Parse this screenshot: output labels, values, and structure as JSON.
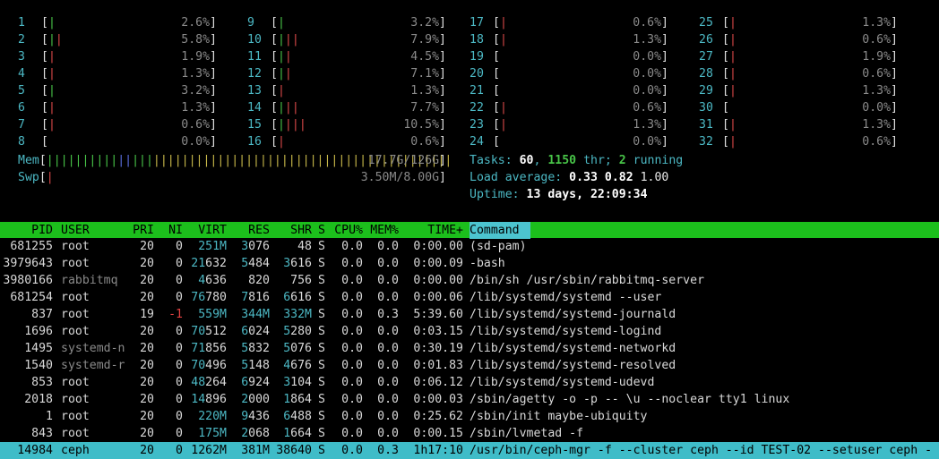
{
  "cpus": [
    {
      "n": "1",
      "pct": "2.6%"
    },
    {
      "n": "2",
      "pct": "5.8%"
    },
    {
      "n": "3",
      "pct": "1.9%"
    },
    {
      "n": "4",
      "pct": "1.3%"
    },
    {
      "n": "5",
      "pct": "3.2%"
    },
    {
      "n": "6",
      "pct": "1.3%"
    },
    {
      "n": "7",
      "pct": "0.6%"
    },
    {
      "n": "8",
      "pct": "0.0%"
    },
    {
      "n": "9",
      "pct": "3.2%"
    },
    {
      "n": "10",
      "pct": "7.9%"
    },
    {
      "n": "11",
      "pct": "4.5%"
    },
    {
      "n": "12",
      "pct": "7.1%"
    },
    {
      "n": "13",
      "pct": "1.3%"
    },
    {
      "n": "14",
      "pct": "7.7%"
    },
    {
      "n": "15",
      "pct": "10.5%"
    },
    {
      "n": "16",
      "pct": "0.6%"
    },
    {
      "n": "17",
      "pct": "0.6%"
    },
    {
      "n": "18",
      "pct": "1.3%"
    },
    {
      "n": "19",
      "pct": "0.0%"
    },
    {
      "n": "20",
      "pct": "0.0%"
    },
    {
      "n": "21",
      "pct": "0.0%"
    },
    {
      "n": "22",
      "pct": "0.6%"
    },
    {
      "n": "23",
      "pct": "1.3%"
    },
    {
      "n": "24",
      "pct": "0.0%"
    },
    {
      "n": "25",
      "pct": "1.3%"
    },
    {
      "n": "26",
      "pct": "0.6%"
    },
    {
      "n": "27",
      "pct": "1.9%"
    },
    {
      "n": "28",
      "pct": "0.6%"
    },
    {
      "n": "29",
      "pct": "1.3%"
    },
    {
      "n": "30",
      "pct": "0.0%"
    },
    {
      "n": "31",
      "pct": "1.3%"
    },
    {
      "n": "32",
      "pct": "0.6%"
    }
  ],
  "mem": {
    "label": "Mem",
    "value": "17.7G/126G"
  },
  "swp": {
    "label": "Swp",
    "value": "3.50M/8.00G"
  },
  "tasks": {
    "label": "Tasks: ",
    "count": "60",
    "sep": ", ",
    "thr": "1150",
    "thr_label": " thr; ",
    "running": "2",
    "running_label": " running"
  },
  "load": {
    "label": "Load average: ",
    "l1": "0.33",
    "l5": "0.82",
    "l15": "1.00"
  },
  "uptime": {
    "label": "Uptime: ",
    "value": "13 days, 22:09:34"
  },
  "columns": [
    "PID",
    "USER",
    "PRI",
    "NI",
    "VIRT",
    "RES",
    "SHR",
    "S",
    "CPU%",
    "MEM%",
    "TIME+",
    "Command"
  ],
  "processes": [
    {
      "pid": "681255",
      "user": "root",
      "pri": "20",
      "ni": "0",
      "virt": "251M",
      "res": "3076",
      "shr": "48",
      "s": "S",
      "cpu": "0.0",
      "mem": "0.0",
      "time": "0:00.00",
      "cmd": "(sd-pam)"
    },
    {
      "pid": "3979643",
      "user": "root",
      "pri": "20",
      "ni": "0",
      "virt": "21632",
      "res": "5484",
      "shr": "3616",
      "s": "S",
      "cpu": "0.0",
      "mem": "0.0",
      "time": "0:00.09",
      "cmd": "-bash"
    },
    {
      "pid": "3980166",
      "user": "rabbitmq",
      "pri": "20",
      "ni": "0",
      "virt": "4636",
      "res": "820",
      "shr": "756",
      "s": "S",
      "cpu": "0.0",
      "mem": "0.0",
      "time": "0:00.00",
      "cmd": "/bin/sh /usr/sbin/rabbitmq-server"
    },
    {
      "pid": "681254",
      "user": "root",
      "pri": "20",
      "ni": "0",
      "virt": "76780",
      "res": "7816",
      "shr": "6616",
      "s": "S",
      "cpu": "0.0",
      "mem": "0.0",
      "time": "0:00.06",
      "cmd": "/lib/systemd/systemd --user"
    },
    {
      "pid": "837",
      "user": "root",
      "pri": "19",
      "ni": "-1",
      "virt": "559M",
      "res": "344M",
      "shr": "332M",
      "s": "S",
      "cpu": "0.0",
      "mem": "0.3",
      "time": "5:39.60",
      "cmd": "/lib/systemd/systemd-journald"
    },
    {
      "pid": "1696",
      "user": "root",
      "pri": "20",
      "ni": "0",
      "virt": "70512",
      "res": "6024",
      "shr": "5280",
      "s": "S",
      "cpu": "0.0",
      "mem": "0.0",
      "time": "0:03.15",
      "cmd": "/lib/systemd/systemd-logind"
    },
    {
      "pid": "1495",
      "user": "systemd-n",
      "pri": "20",
      "ni": "0",
      "virt": "71856",
      "res": "5832",
      "shr": "5076",
      "s": "S",
      "cpu": "0.0",
      "mem": "0.0",
      "time": "0:30.19",
      "cmd": "/lib/systemd/systemd-networkd"
    },
    {
      "pid": "1540",
      "user": "systemd-r",
      "pri": "20",
      "ni": "0",
      "virt": "70496",
      "res": "5148",
      "shr": "4676",
      "s": "S",
      "cpu": "0.0",
      "mem": "0.0",
      "time": "0:01.83",
      "cmd": "/lib/systemd/systemd-resolved"
    },
    {
      "pid": "853",
      "user": "root",
      "pri": "20",
      "ni": "0",
      "virt": "48264",
      "res": "6924",
      "shr": "3104",
      "s": "S",
      "cpu": "0.0",
      "mem": "0.0",
      "time": "0:06.12",
      "cmd": "/lib/systemd/systemd-udevd"
    },
    {
      "pid": "2018",
      "user": "root",
      "pri": "20",
      "ni": "0",
      "virt": "14896",
      "res": "2000",
      "shr": "1864",
      "s": "S",
      "cpu": "0.0",
      "mem": "0.0",
      "time": "0:00.03",
      "cmd": "/sbin/agetty -o -p -- \\u --noclear tty1 linux"
    },
    {
      "pid": "1",
      "user": "root",
      "pri": "20",
      "ni": "0",
      "virt": "220M",
      "res": "9436",
      "shr": "6488",
      "s": "S",
      "cpu": "0.0",
      "mem": "0.0",
      "time": "0:25.62",
      "cmd": "/sbin/init maybe-ubiquity"
    },
    {
      "pid": "843",
      "user": "root",
      "pri": "20",
      "ni": "0",
      "virt": "175M",
      "res": "2068",
      "shr": "1664",
      "s": "S",
      "cpu": "0.0",
      "mem": "0.0",
      "time": "0:00.15",
      "cmd": "/sbin/lvmetad -f"
    },
    {
      "pid": "14984",
      "user": "ceph",
      "pri": "20",
      "ni": "0",
      "virt": "1262M",
      "res": "381M",
      "shr": "38640",
      "s": "S",
      "cpu": "0.0",
      "mem": "0.3",
      "time": "1h17:10",
      "cmd": "/usr/bin/ceph-mgr -f --cluster ceph --id TEST-02 --setuser ceph -"
    }
  ],
  "selected_index": 12
}
